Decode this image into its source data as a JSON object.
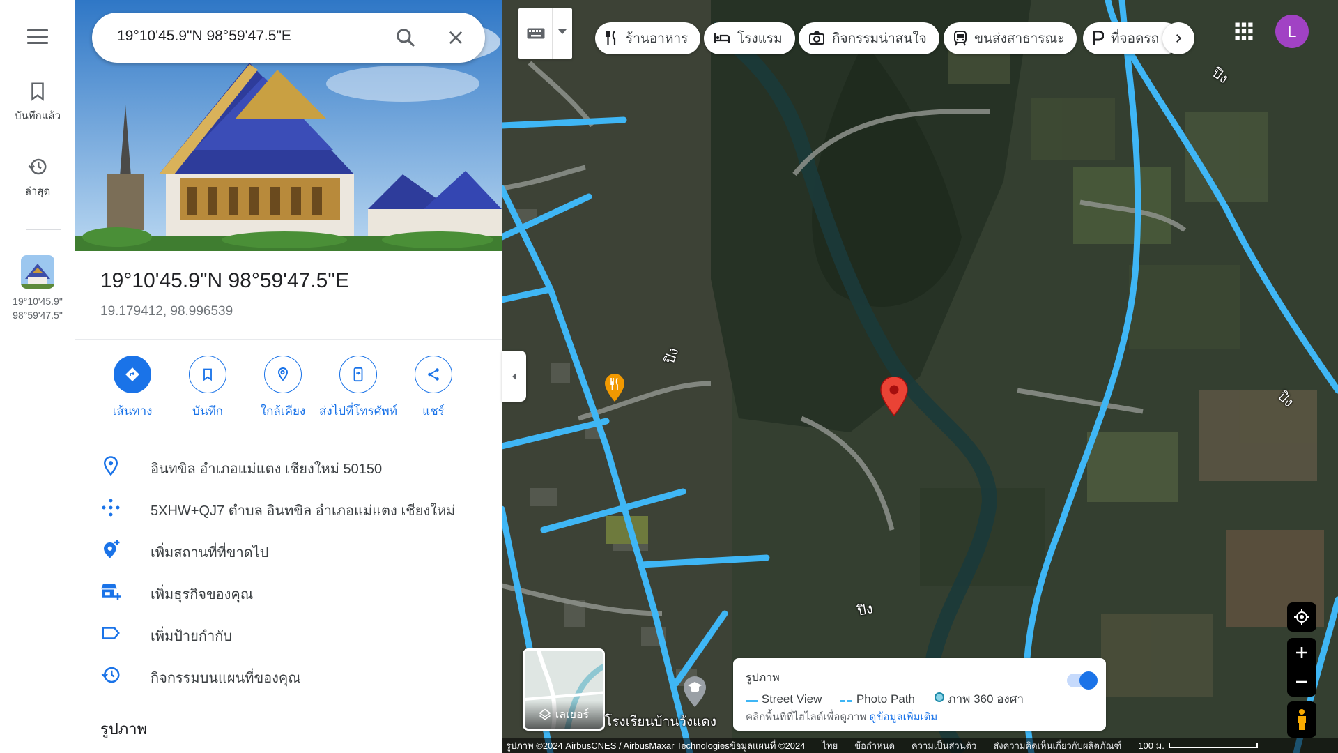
{
  "rail": {
    "saved_label": "บันทึกแล้ว",
    "recent_label": "ล่าสุด",
    "recent_item_line1": "19°10'45.9\"",
    "recent_item_line2": "98°59'47.5\""
  },
  "search": {
    "query": "19°10'45.9\"N 98°59'47.5\"E"
  },
  "place": {
    "title": "19°10'45.9\"N 98°59'47.5\"E",
    "decimal_coords": "19.179412, 98.996539"
  },
  "actions": [
    {
      "label": "เส้นทาง"
    },
    {
      "label": "บันทึก"
    },
    {
      "label": "ใกล้เคียง"
    },
    {
      "label": "ส่งไปที่โทรศัพท์"
    },
    {
      "label": "แชร์"
    }
  ],
  "info": [
    {
      "icon": "location-pin-icon",
      "text": "อินทขิล อำเภอแม่แตง เชียงใหม่ 50150"
    },
    {
      "icon": "plus-code-icon",
      "text": "5XHW+QJ7 ตำบล อินทขิล อำเภอแม่แตง เชียงใหม่"
    },
    {
      "icon": "add-place-icon",
      "text": "เพิ่มสถานที่ที่ขาดไป"
    },
    {
      "icon": "add-business-icon",
      "text": "เพิ่มธุรกิจของคุณ"
    },
    {
      "icon": "label-icon",
      "text": "เพิ่มป้ายกำกับ"
    },
    {
      "icon": "history-icon",
      "text": "กิจกรรมบนแผนที่ของคุณ"
    }
  ],
  "photos_heading": "รูปภาพ",
  "chips": [
    {
      "icon": "restaurant-icon",
      "label": "ร้านอาหาร"
    },
    {
      "icon": "hotel-icon",
      "label": "โรงแรม"
    },
    {
      "icon": "camera-icon",
      "label": "กิจกรรมน่าสนใจ"
    },
    {
      "icon": "transit-icon",
      "label": "ขนส่งสาธารณะ"
    },
    {
      "icon": "parking-icon",
      "label": "ที่จอดรถ"
    }
  ],
  "avatar_letter": "L",
  "map_labels": {
    "river": "ปิง",
    "school": "โรงเรียนบ้านวังแดง"
  },
  "layers_label": "เลเยอร์",
  "streetview_legend": {
    "title": "รูปภาพ",
    "street_view": "Street View",
    "photo_path": "Photo Path",
    "photo_360": "ภาพ 360 องศา",
    "hint": "คลิกพื้นที่ที่ไฮไลต์เพื่อดูภาพ",
    "more_link": "ดูข้อมูลเพิ่มเติม",
    "toggle_on": true
  },
  "footer": {
    "imagery": "รูปภาพ ©2024 AirbusCNES / AirbusMaxar Technologiesข้อมูลแผนที่ ©2024",
    "lang": "ไทย",
    "terms": "ข้อกำหนด",
    "privacy": "ความเป็นส่วนตัว",
    "feedback": "ส่งความคิดเห็นเกี่ยวกับผลิตภัณฑ์",
    "scale": "100 ม."
  },
  "colors": {
    "accent": "#1a73e8",
    "streetview_line": "#3fb6f5",
    "pin": "#ea4335",
    "avatar": "#a142c4"
  }
}
